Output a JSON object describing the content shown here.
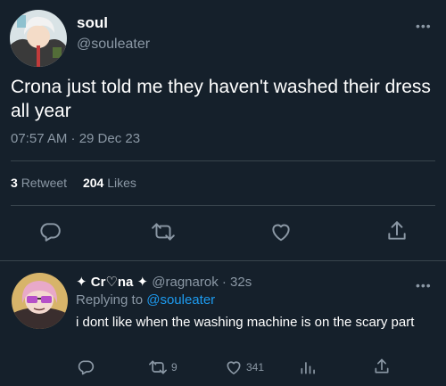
{
  "tweet": {
    "display_name": "soul",
    "handle": "@souleater",
    "text": "Crona just told me they haven't washed their dress all year",
    "timestamp": "07:57 AM · 29 Dec 23",
    "retweets_count": "3",
    "retweets_label": "Retweet",
    "likes_count": "204",
    "likes_label": "Likes"
  },
  "reply": {
    "display_name": "✦ Cr♡na ✦",
    "handle": "@ragnarok",
    "time": "· 32s",
    "replying_to_label": "Replying to",
    "replying_to_handle": "@souleater",
    "text": "i dont like when the washing machine is on the scary part",
    "retweet_count": "9",
    "like_count": "341"
  },
  "icons": {
    "more": "more-dots-icon",
    "reply": "reply-icon",
    "retweet": "retweet-icon",
    "like": "heart-icon",
    "share": "share-icon",
    "views": "views-icon"
  },
  "colors": {
    "background": "#15202b",
    "text_primary": "#ffffff",
    "text_secondary": "#8b98a5",
    "link": "#1d9bf0",
    "divider": "#38444d"
  }
}
